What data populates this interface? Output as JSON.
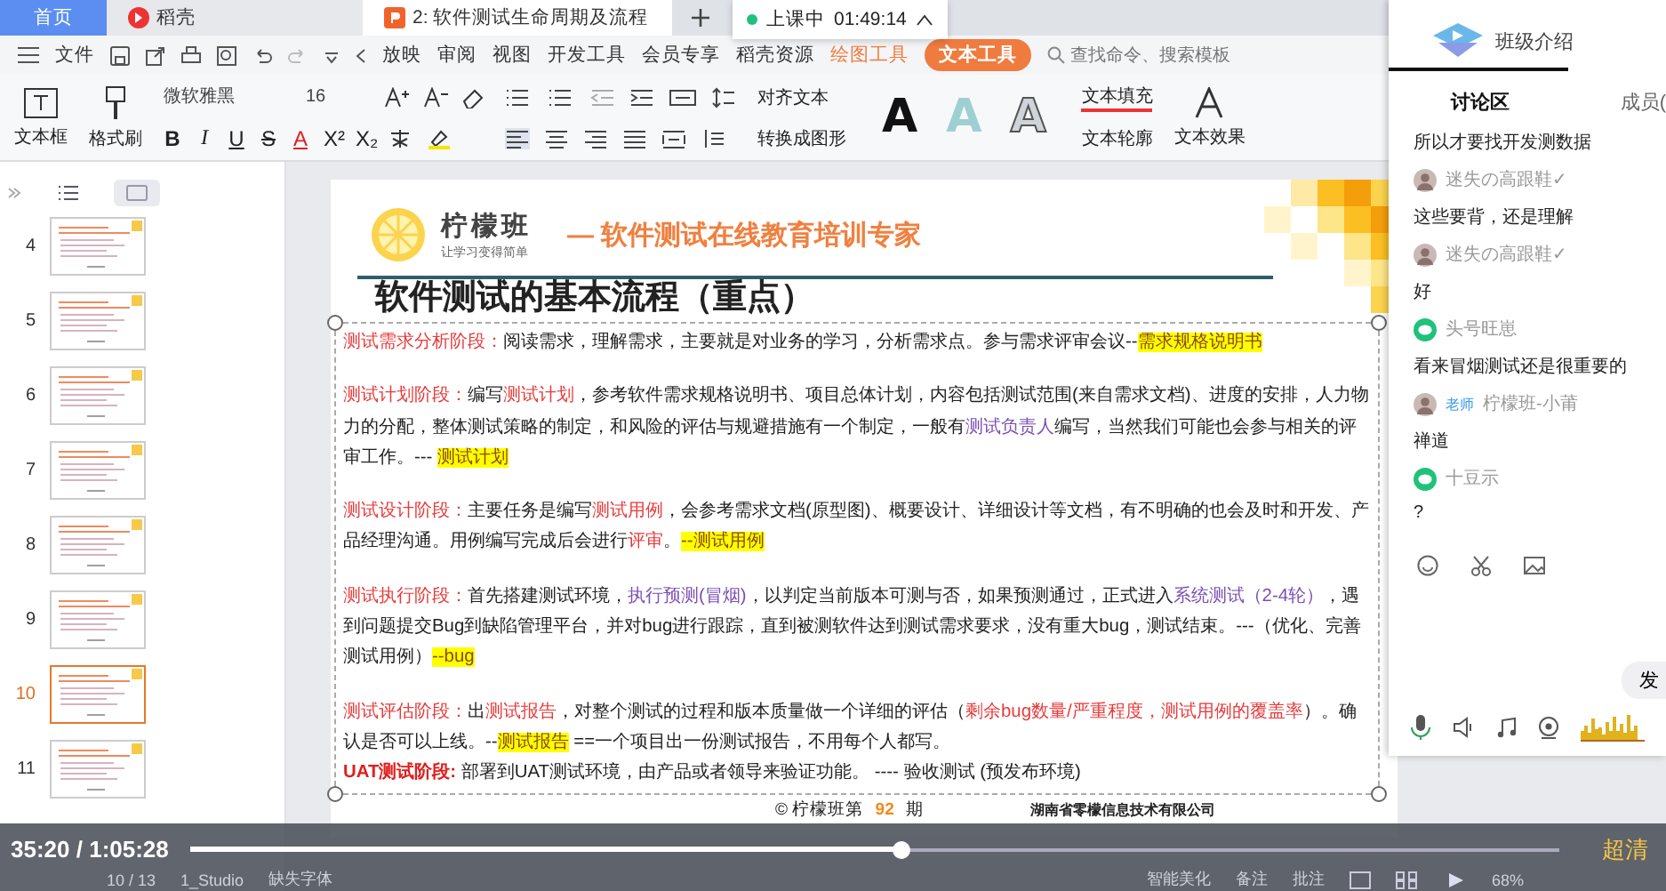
{
  "browser_tabs": [
    {
      "label": "首页",
      "kind": "home",
      "selected": false
    },
    {
      "label": "稻壳",
      "kind": "app",
      "selected": false
    },
    {
      "label": "2: 软件测试生命周期及流程",
      "kind": "doc",
      "selected": true
    }
  ],
  "live": {
    "status": "上课中",
    "time": "01:49:14"
  },
  "menu": [
    {
      "label": "文件",
      "kind": "plain"
    },
    {
      "label": "放映",
      "kind": "plain"
    },
    {
      "label": "审阅",
      "kind": "plain"
    },
    {
      "label": "视图",
      "kind": "plain"
    },
    {
      "label": "开发工具",
      "kind": "plain"
    },
    {
      "label": "会员专享",
      "kind": "plain"
    },
    {
      "label": "稻壳资源",
      "kind": "plain"
    },
    {
      "label": "绘图工具",
      "kind": "accent"
    },
    {
      "label": "文本工具",
      "kind": "pill"
    }
  ],
  "search": {
    "placeholder": "查找命令、搜索模板"
  },
  "toolbar": {
    "text_box": "文本框",
    "format_painter": "格式刷",
    "font": "微软雅黑",
    "size": "16",
    "format_buttons": [
      "B",
      "I",
      "U",
      "S",
      "A",
      "X²",
      "X₂"
    ],
    "align_text": "对齐文本",
    "convert_shape": "转换成图形",
    "style_samples": [
      "A",
      "A",
      "A"
    ],
    "text_fill": "文本填充",
    "text_outline": "文本轮廓",
    "text_effects": "文本效果"
  },
  "thumbnails": [
    {
      "number": "4",
      "selected": false
    },
    {
      "number": "5",
      "selected": false
    },
    {
      "number": "6",
      "selected": false
    },
    {
      "number": "7",
      "selected": false
    },
    {
      "number": "8",
      "selected": false
    },
    {
      "number": "9",
      "selected": false
    },
    {
      "number": "10",
      "selected": true
    },
    {
      "number": "11",
      "selected": false
    }
  ],
  "slide": {
    "brand": "柠檬班",
    "slogan": "让学习变得简单",
    "tagline": "— 软件测试在线教育培训专家",
    "title": "软件测试的基本流程（重点）",
    "paragraphs": [
      {
        "lines": [
          [
            {
              "text": "测试需求分析阶段：",
              "kind": "red"
            },
            {
              "text": "阅读需求，理解需求，主要就是对业务的学习，分析需求点。参与需求评审会议--",
              "kind": "plain"
            },
            {
              "text": "需求规格说明书",
              "kind": "mark"
            }
          ]
        ]
      },
      {
        "lines": [
          [
            {
              "text": "测试计划阶段：",
              "kind": "red"
            },
            {
              "text": "编写",
              "kind": "plain"
            },
            {
              "text": "测试计划",
              "kind": "red"
            },
            {
              "text": "，参考软件需求规格说明书、项目总体计划，内容包括测试范围(来自需求文档)、进度的安排，人力物力的分配，整体测试策略的制定，和风险的评估与规避措施有一个制定，一般有",
              "kind": "plain"
            },
            {
              "text": "测试负责人",
              "kind": "purple"
            },
            {
              "text": "编写，当然我们可能也会参与相关的评审工作。--- ",
              "kind": "plain"
            },
            {
              "text": "测试计划",
              "kind": "mark"
            }
          ]
        ]
      },
      {
        "lines": [
          [
            {
              "text": "测试设计阶段：",
              "kind": "red"
            },
            {
              "text": "主要任务是编写",
              "kind": "plain"
            },
            {
              "text": "测试用例",
              "kind": "red"
            },
            {
              "text": "，会参考需求文档(原型图)、概要设计、详细设计等文档，有不明确的也会及时和开发、产品经理沟通。用例编写完成后会进行",
              "kind": "plain"
            },
            {
              "text": "评审",
              "kind": "red"
            },
            {
              "text": "。",
              "kind": "plain"
            },
            {
              "text": "--测试用例",
              "kind": "mark"
            }
          ]
        ]
      },
      {
        "lines": [
          [
            {
              "text": "测试执行阶段：",
              "kind": "red"
            },
            {
              "text": "首先搭建测试环境，",
              "kind": "plain"
            },
            {
              "text": "执行预测(冒烟)",
              "kind": "purple"
            },
            {
              "text": "，以判定当前版本可测与否，如果预测通过，正式进入",
              "kind": "plain"
            },
            {
              "text": "系统测试（2-4轮）",
              "kind": "purple"
            },
            {
              "text": "，遇到问题提交Bug到缺陷管理平台，并对bug进行跟踪，直到被测软件达到测试需求要求，没有重大bug，测试结束。---（优化、完善测试用例）",
              "kind": "plain"
            },
            {
              "text": "--bug",
              "kind": "mark"
            }
          ]
        ]
      },
      {
        "lines": [
          [
            {
              "text": "测试评估阶段：",
              "kind": "red"
            },
            {
              "text": "出",
              "kind": "plain"
            },
            {
              "text": "测试报告",
              "kind": "red"
            },
            {
              "text": "，对整个测试的过程和版本质量做一个详细的评估（",
              "kind": "plain"
            },
            {
              "text": "剩余bug数量/严重程度，测试用例的覆盖率",
              "kind": "red"
            },
            {
              "text": "）。确认是否可以上线。--",
              "kind": "plain"
            },
            {
              "text": "测试报告",
              "kind": "mark"
            },
            {
              "text": "  ==一个项目出一份测试报告，不用每个人都写。",
              "kind": "plain"
            }
          ],
          [
            {
              "text": "UAT测试阶段:",
              "kind": "strong"
            },
            {
              "text": " 部署到UAT测试环境，由产品或者领导来验证功能。  ---- 验收测试 (预发布环境)",
              "kind": "plain"
            }
          ]
        ]
      }
    ],
    "footer_before": "© 柠檬班第",
    "footer_number": "92",
    "footer_after": "期",
    "company": "湖南省零檬信息技术有限公司"
  },
  "chat": {
    "header": "班级介绍",
    "tabs": [
      {
        "label": "讨论区",
        "selected": true
      },
      {
        "label": "成员(",
        "selected": false
      }
    ],
    "messages": [
      {
        "kind": "text",
        "text": "所以才要找开发测数据"
      },
      {
        "kind": "photouser",
        "name": "迷失の高跟鞋✓"
      },
      {
        "kind": "text",
        "text": "这些要背，还是理解"
      },
      {
        "kind": "photouser",
        "name": "迷失の高跟鞋✓"
      },
      {
        "kind": "text",
        "text": "好"
      },
      {
        "kind": "wechatuser",
        "name": "头号旺崽"
      },
      {
        "kind": "text",
        "text": "看来冒烟测试还是很重要的"
      },
      {
        "kind": "photouser",
        "name": "柠檬班-小莆",
        "tag": "老师"
      },
      {
        "kind": "text",
        "text": "禅道"
      },
      {
        "kind": "wechatuser",
        "name": "十豆示"
      },
      {
        "kind": "text",
        "text": "?"
      }
    ],
    "send": "发"
  },
  "video": {
    "time": "35:20 / 1:05:28",
    "level": 0.52,
    "quality": "超清"
  },
  "status_bar": {
    "page": "10 / 13",
    "theme": "1_Studio",
    "missing_font": "缺失字体",
    "beautify": "智能美化",
    "notes": "备注",
    "comments": "批注",
    "zoom": "68%"
  }
}
